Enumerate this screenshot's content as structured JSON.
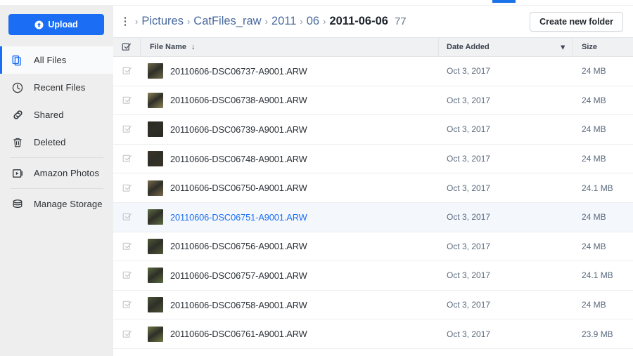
{
  "window": {
    "tab_indicator_color": "#1a73e8"
  },
  "sidebar": {
    "upload_label": "Upload",
    "upload_icon": "upload-circle-icon",
    "items": [
      {
        "label": "All Files",
        "icon": "files-icon",
        "active": true
      },
      {
        "label": "Recent Files",
        "icon": "clock-icon",
        "active": false
      },
      {
        "label": "Shared",
        "icon": "link-icon",
        "active": false
      },
      {
        "label": "Deleted",
        "icon": "trash-icon",
        "active": false
      },
      {
        "label": "Amazon Photos",
        "icon": "photos-icon",
        "active": false
      },
      {
        "label": "Manage Storage",
        "icon": "database-icon",
        "active": false
      }
    ],
    "background_color": "#eeeeee",
    "accent_color": "#1b6ef3"
  },
  "toolbar": {
    "menu_icon": "kebab-menu-icon",
    "breadcrumb": [
      {
        "label": "Pictures",
        "current": false
      },
      {
        "label": "CatFiles_raw",
        "current": false
      },
      {
        "label": "2011",
        "current": false
      },
      {
        "label": "06",
        "current": false
      },
      {
        "label": "2011-06-06",
        "current": true
      }
    ],
    "breadcrumb_separator": "›",
    "item_count": "77",
    "create_folder_label": "Create new folder"
  },
  "table": {
    "columns": {
      "select_all_icon": "checkbox-checked-icon",
      "name": "File Name",
      "name_sort_icon": "↓",
      "date": "Date Added",
      "date_sort_icon": "▾",
      "size": "Size"
    },
    "rows": [
      {
        "name": "20110606-DSC06737-A9001.ARW",
        "date": "Oct 3, 2017",
        "size": "24 MB",
        "selected": false,
        "thumb": "#6e6a4a"
      },
      {
        "name": "20110606-DSC06738-A9001.ARW",
        "date": "Oct 3, 2017",
        "size": "24 MB",
        "selected": false,
        "thumb": "#8c8458"
      },
      {
        "name": "20110606-DSC06739-A9001.ARW",
        "date": "Oct 3, 2017",
        "size": "24 MB",
        "selected": false,
        "thumb": "#2a2a22"
      },
      {
        "name": "20110606-DSC06748-A9001.ARW",
        "date": "Oct 3, 2017",
        "size": "24 MB",
        "selected": false,
        "thumb": "#3b3326"
      },
      {
        "name": "20110606-DSC06750-A9001.ARW",
        "date": "Oct 3, 2017",
        "size": "24.1 MB",
        "selected": false,
        "thumb": "#7a6a4c"
      },
      {
        "name": "20110606-DSC06751-A9001.ARW",
        "date": "Oct 3, 2017",
        "size": "24 MB",
        "selected": true,
        "thumb": "#5e6d42"
      },
      {
        "name": "20110606-DSC06756-A9001.ARW",
        "date": "Oct 3, 2017",
        "size": "24 MB",
        "selected": false,
        "thumb": "#4e5a36"
      },
      {
        "name": "20110606-DSC06757-A9001.ARW",
        "date": "Oct 3, 2017",
        "size": "24.1 MB",
        "selected": false,
        "thumb": "#5a6a3e"
      },
      {
        "name": "20110606-DSC06758-A9001.ARW",
        "date": "Oct 3, 2017",
        "size": "24 MB",
        "selected": false,
        "thumb": "#4a5436"
      },
      {
        "name": "20110606-DSC06761-A9001.ARW",
        "date": "Oct 3, 2017",
        "size": "23.9 MB",
        "selected": false,
        "thumb": "#6f7a46"
      }
    ]
  }
}
